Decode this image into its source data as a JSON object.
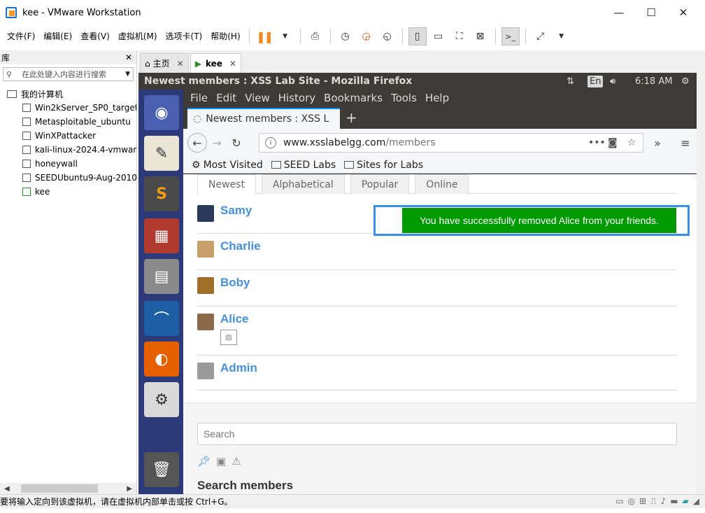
{
  "window": {
    "title": "kee - VMware Workstation",
    "minimize": "—",
    "maximize": "☐",
    "close": "✕"
  },
  "menu": [
    "文件(F)",
    "编辑(E)",
    "查看(V)",
    "虚拟机(M)",
    "选项卡(T)",
    "帮助(H)"
  ],
  "toolbar_icons": [
    "pause-icon",
    "send-keys-icon",
    "snapshot-icon",
    "revert-snapshot-icon",
    "snapshot-manager-icon",
    "library-view-icon",
    "console-view-icon",
    "fullscreen-icon",
    "unity-icon",
    "terminal-icon",
    "stretch-icon"
  ],
  "library": {
    "title": "库",
    "close": "✕",
    "search_placeholder": "在此处键入内容进行搜索",
    "root": "我的计算机",
    "vms": [
      "Win2kServer_SP0_target",
      "Metasploitable_ubuntu",
      "WinXPattacker",
      "kali-linux-2024.4-vmware",
      "honeywall",
      "SEEDUbuntu9-Aug-2010",
      "kee"
    ]
  },
  "tabs": [
    {
      "label": "主页",
      "close": "✕"
    },
    {
      "label": "kee",
      "close": "✕"
    }
  ],
  "guest": {
    "window_title": "Newest members : XSS Lab Site - Mozilla Firefox",
    "lang": "En",
    "time": "6:18 AM",
    "ff_menu": [
      "File",
      "Edit",
      "View",
      "History",
      "Bookmarks",
      "Tools",
      "Help"
    ],
    "tab_title": "Newest members : XSS L",
    "new_tab": "+",
    "url_host": "www.xsslabelgg.com",
    "url_path": "/members",
    "bookmarks": [
      "Most Visited",
      "SEED Labs",
      "Sites for Labs"
    ]
  },
  "page": {
    "tabs": [
      "Newest",
      "Alphabetical",
      "Popular",
      "Online"
    ],
    "members": [
      "Samy",
      "Charlie",
      "Boby",
      "Alice",
      "Admin"
    ],
    "notice": "You have successfully removed Alice from your friends.",
    "search_placeholder": "Search",
    "search_heading": "Search members"
  },
  "status": {
    "message": "要将输入定向到该虚拟机，请在虚拟机内部单击或按 Ctrl+G。"
  },
  "colors": {
    "accent_orange": "#f08a24",
    "link_blue": "#4690d6",
    "notice_green": "#009900",
    "launcher": "#2c3a7a",
    "ubuntu_bar": "#3c3b37"
  }
}
